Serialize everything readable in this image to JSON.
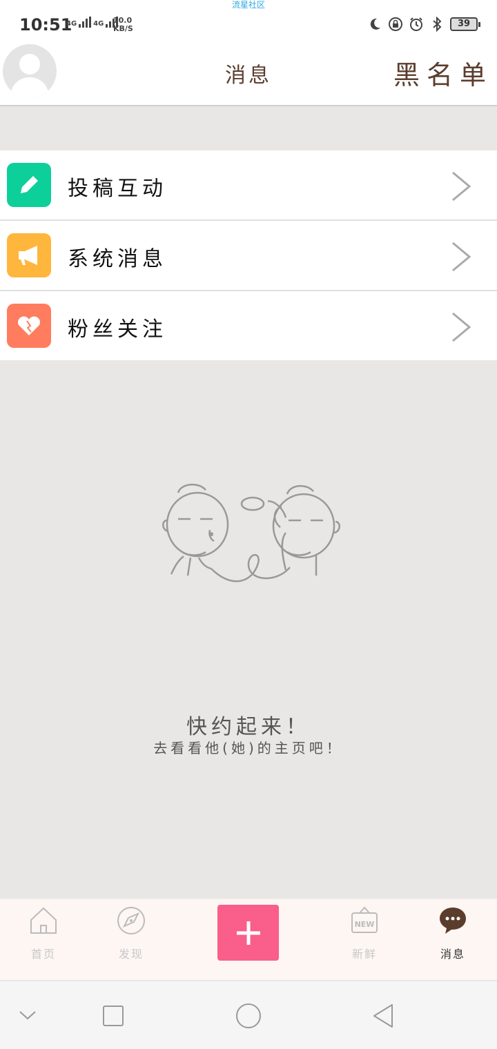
{
  "status_bar": {
    "app_name": "流星社区",
    "time": "10:51",
    "net1": "4G",
    "net2": "4G",
    "speed_value": "10.0",
    "speed_unit": "KB/S",
    "battery": "39"
  },
  "header": {
    "title": "消息",
    "blacklist_label": "黑名单"
  },
  "menu": {
    "items": [
      {
        "label": "投稿互动",
        "icon": "pencil-icon",
        "color": "#0dcf9a"
      },
      {
        "label": "系统消息",
        "icon": "megaphone-icon",
        "color": "#ffb63c"
      },
      {
        "label": "粉丝关注",
        "icon": "heart-icon",
        "color": "#ff7c5e"
      }
    ]
  },
  "empty_state": {
    "title": "快约起来！",
    "subtitle": "去看看他(她)的主页吧！"
  },
  "tabbar": {
    "tabs": [
      {
        "label": "首页",
        "icon": "home-icon"
      },
      {
        "label": "发现",
        "icon": "compass-icon"
      },
      {
        "label": "",
        "icon": "plus-icon"
      },
      {
        "label": "新鲜",
        "icon": "new-badge-icon"
      },
      {
        "label": "消息",
        "icon": "chat-bubble-icon"
      }
    ],
    "new_badge_text": "NEW",
    "add_color": "#fa5e8b",
    "active_tab": "消息"
  },
  "colors": {
    "title_brown": "#5b3d2e",
    "background": "#e8e7e6"
  }
}
